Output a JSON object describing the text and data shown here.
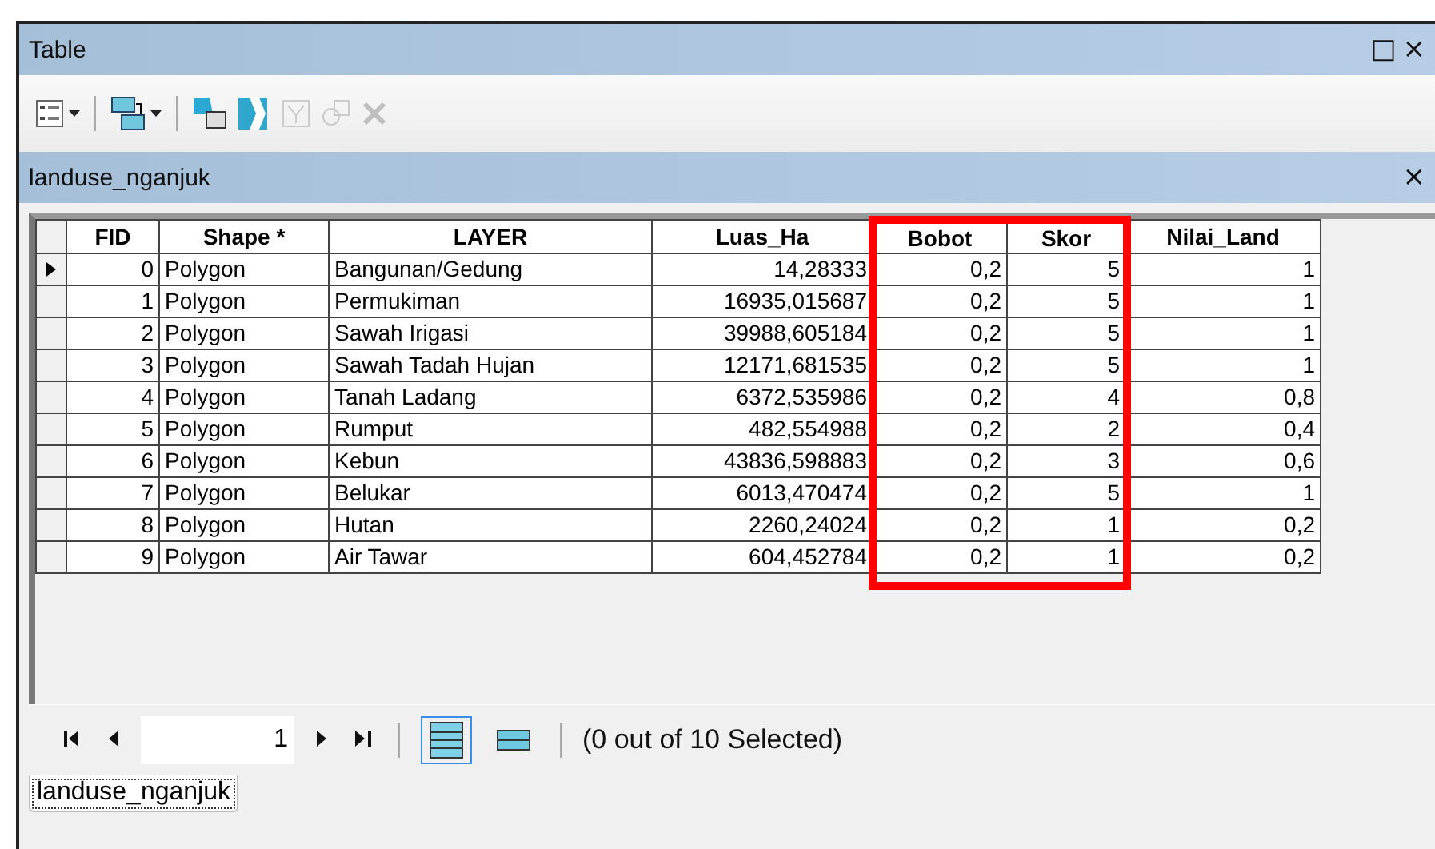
{
  "window": {
    "title": "Table",
    "buttons": [
      "□",
      "×"
    ]
  },
  "toolbar": {
    "items": [
      {
        "kind": "options",
        "disabled": false,
        "dropdown": true
      },
      {
        "kind": "relate",
        "disabled": false,
        "dropdown": true
      },
      {
        "kind": "layout",
        "disabled": false,
        "dropdown": false
      },
      {
        "kind": "switch",
        "disabled": false,
        "dropdown": false
      },
      {
        "kind": "clear",
        "disabled": true,
        "dropdown": false
      },
      {
        "kind": "zoom",
        "disabled": true,
        "dropdown": false
      },
      {
        "kind": "delete",
        "disabled": true,
        "dropdown": false
      }
    ]
  },
  "table": {
    "title": "landuse_nganjuk",
    "close": "×",
    "columns": [
      {
        "label": "FID",
        "highlighted": false
      },
      {
        "label": "Shape *",
        "highlighted": false
      },
      {
        "label": "LAYER",
        "highlighted": false
      },
      {
        "label": "Luas_Ha",
        "highlighted": false
      },
      {
        "label": "Bobot",
        "highlighted": true
      },
      {
        "label": "Skor",
        "highlighted": true
      },
      {
        "label": "Nilai_Land",
        "highlighted": false
      }
    ],
    "rows": [
      {
        "current": true,
        "cells": [
          "0",
          "Polygon",
          "Bangunan/Gedung",
          "14,28333",
          "0,2",
          "5",
          "1"
        ]
      },
      {
        "current": false,
        "cells": [
          "1",
          "Polygon",
          "Permukiman",
          "16935,015687",
          "0,2",
          "5",
          "1"
        ]
      },
      {
        "current": false,
        "cells": [
          "2",
          "Polygon",
          "Sawah Irigasi",
          "39988,605184",
          "0,2",
          "5",
          "1"
        ]
      },
      {
        "current": false,
        "cells": [
          "3",
          "Polygon",
          "Sawah Tadah Hujan",
          "12171,681535",
          "0,2",
          "5",
          "1"
        ]
      },
      {
        "current": false,
        "cells": [
          "4",
          "Polygon",
          "Tanah Ladang",
          "6372,535986",
          "0,2",
          "4",
          "0,8"
        ]
      },
      {
        "current": false,
        "cells": [
          "5",
          "Polygon",
          "Rumput",
          "482,554988",
          "0,2",
          "2",
          "0,4"
        ]
      },
      {
        "current": false,
        "cells": [
          "6",
          "Polygon",
          "Kebun",
          "43836,598883",
          "0,2",
          "3",
          "0,6"
        ]
      },
      {
        "current": false,
        "cells": [
          "7",
          "Polygon",
          "Belukar",
          "6013,470474",
          "0,2",
          "5",
          "1"
        ]
      },
      {
        "current": false,
        "cells": [
          "8",
          "Polygon",
          "Hutan",
          "2260,24024",
          "0,2",
          "1",
          "0,2"
        ]
      },
      {
        "current": false,
        "cells": [
          "9",
          "Polygon",
          "Air Tawar",
          "604,452784",
          "0,2",
          "1",
          "0,2"
        ]
      }
    ]
  },
  "footer": {
    "record": "1",
    "views": [
      {
        "kind": "all",
        "selected": true
      },
      {
        "kind": "selected",
        "selected": false
      }
    ],
    "status": "(0 out of 10 Selected)"
  },
  "tabs": [
    {
      "label": "landuse_nganjuk",
      "selected": true
    }
  ]
}
